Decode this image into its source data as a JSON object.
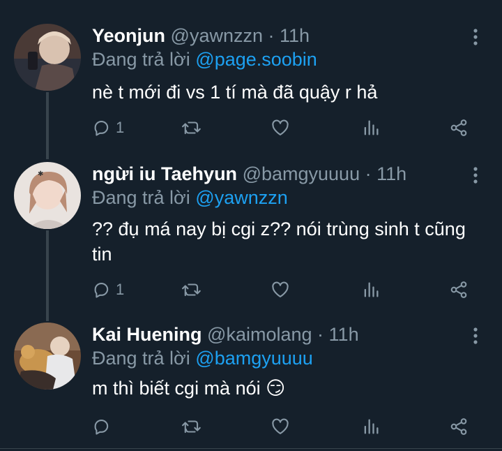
{
  "replying_label": "Đang trả lời",
  "colors": {
    "background": "#15202b",
    "text": "#ffffff",
    "muted": "#8899a6",
    "mention": "#1da1f2",
    "line": "#38444d"
  },
  "icons": {
    "more": "more-vertical-icon",
    "reply": "reply-icon",
    "retweet": "retweet-icon",
    "like": "heart-icon",
    "stats": "bar-chart-icon",
    "share": "share-icon"
  },
  "tweets": [
    {
      "name": "Yeonjun",
      "handle": "@yawnzzn",
      "dot": "·",
      "time": "11h",
      "reply_to": "@page.soobin",
      "text": "nè t mới đi vs 1 tí mà đã quậy r hả",
      "reply_count": "1"
    },
    {
      "name": "ngừi iu Taehyun",
      "handle": "@bamgyuuuu",
      "dot": "·",
      "time": "11h",
      "reply_to": "@yawnzzn",
      "text": "?? đụ má nay bị cgi z?? nói trùng sinh t cũng tin",
      "reply_count": "1"
    },
    {
      "name": "Kai Huening",
      "handle": "@kaimolang",
      "dot": "·",
      "time": "11h",
      "reply_to": "@bamgyuuuu",
      "text": "m thì biết cgi mà nói 😏",
      "reply_count": ""
    }
  ]
}
